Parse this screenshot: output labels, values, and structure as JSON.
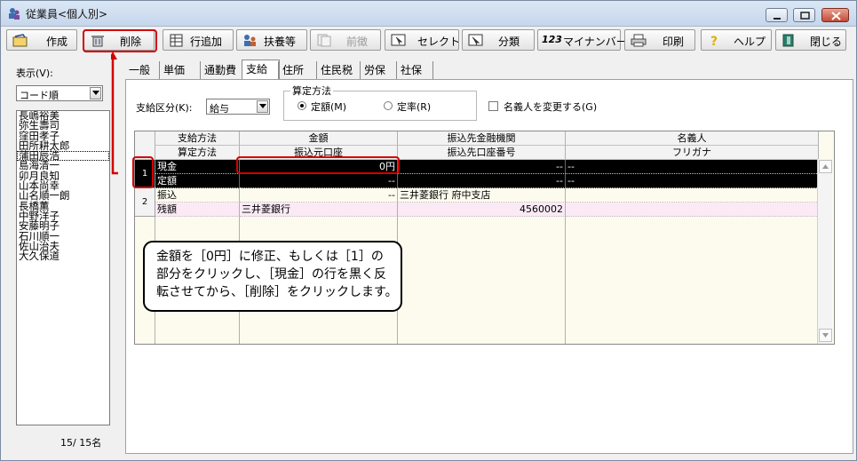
{
  "window": {
    "title": "従業員<個人別>"
  },
  "toolbar": {
    "buttons": [
      {
        "label": "作成",
        "icon": "create-icon"
      },
      {
        "label": "削除",
        "icon": "delete-icon"
      },
      {
        "label": "行追加",
        "icon": "add-row-icon"
      },
      {
        "label": "扶養等",
        "icon": "dependents-icon"
      },
      {
        "label": "前徴",
        "icon": "prior-collection-icon",
        "disabled": true
      },
      {
        "label": "セレクト",
        "icon": "select-icon"
      },
      {
        "label": "分類",
        "icon": "classify-icon"
      },
      {
        "label": "マイナンバー",
        "icon": "mynumber-icon"
      },
      {
        "label": "印刷",
        "icon": "print-icon"
      },
      {
        "label": "ヘルプ",
        "icon": "help-icon"
      },
      {
        "label": "閉じる",
        "icon": "close-icon"
      }
    ],
    "mynumber_badge": "123"
  },
  "sidebar": {
    "display_label": "表示(V):",
    "sort_value": "コード順",
    "employees": [
      "長嶋裕美",
      "弥生壽司",
      "窪田孝子",
      "田所耕太郎",
      "蒲田辰浩",
      "島海清一",
      "卯月良知",
      "山本尚幸",
      "山名順一朗",
      "長橋薫",
      "中野洋子",
      "安藤明子",
      "石川順一",
      "佐山治夫",
      "大久保道"
    ],
    "count": "15/  15名"
  },
  "tabs": [
    "一般",
    "単価",
    "通勤費",
    "支給",
    "住所",
    "住民税",
    "労保",
    "社保"
  ],
  "active_tab": "支給",
  "form": {
    "pay_category_label": "支給区分(K):",
    "pay_category_value": "給与",
    "calc_method_legend": "算定方法",
    "radio_fixed": "定額(M)",
    "radio_rate": "定率(R)",
    "rename_checkbox": "名義人を変更する(G)"
  },
  "grid": {
    "headers_top": [
      "支給方法",
      "金額",
      "振込先金融機関",
      "名義人"
    ],
    "headers_bottom": [
      "算定方法",
      "振込元口座",
      "振込先口座番号",
      "フリガナ"
    ],
    "rows": [
      {
        "num": "1",
        "method": "現金",
        "amount": "0円",
        "bank": "--",
        "name": "--",
        "calc": "定額",
        "src_account": "--",
        "dest_account": "--",
        "kana": "--"
      },
      {
        "num": "2",
        "method": "振込",
        "amount": "--",
        "bank": "三井菱銀行 府中支店",
        "name": "",
        "calc": "残額",
        "src_account": "三井菱銀行",
        "dest_account": "4560002",
        "kana": ""
      }
    ]
  },
  "callout": {
    "lines": [
      "金額を［0円］に修正、もしくは［1］の",
      "部分をクリックし、［現金］の行を黒く反",
      "転させてから、［削除］をクリックします。"
    ]
  },
  "colors": {
    "annotation_red": "#d40000",
    "selected_row": "#000000",
    "transfer_row": "#fbeaf6",
    "grid_bg": "#fdfbee"
  }
}
